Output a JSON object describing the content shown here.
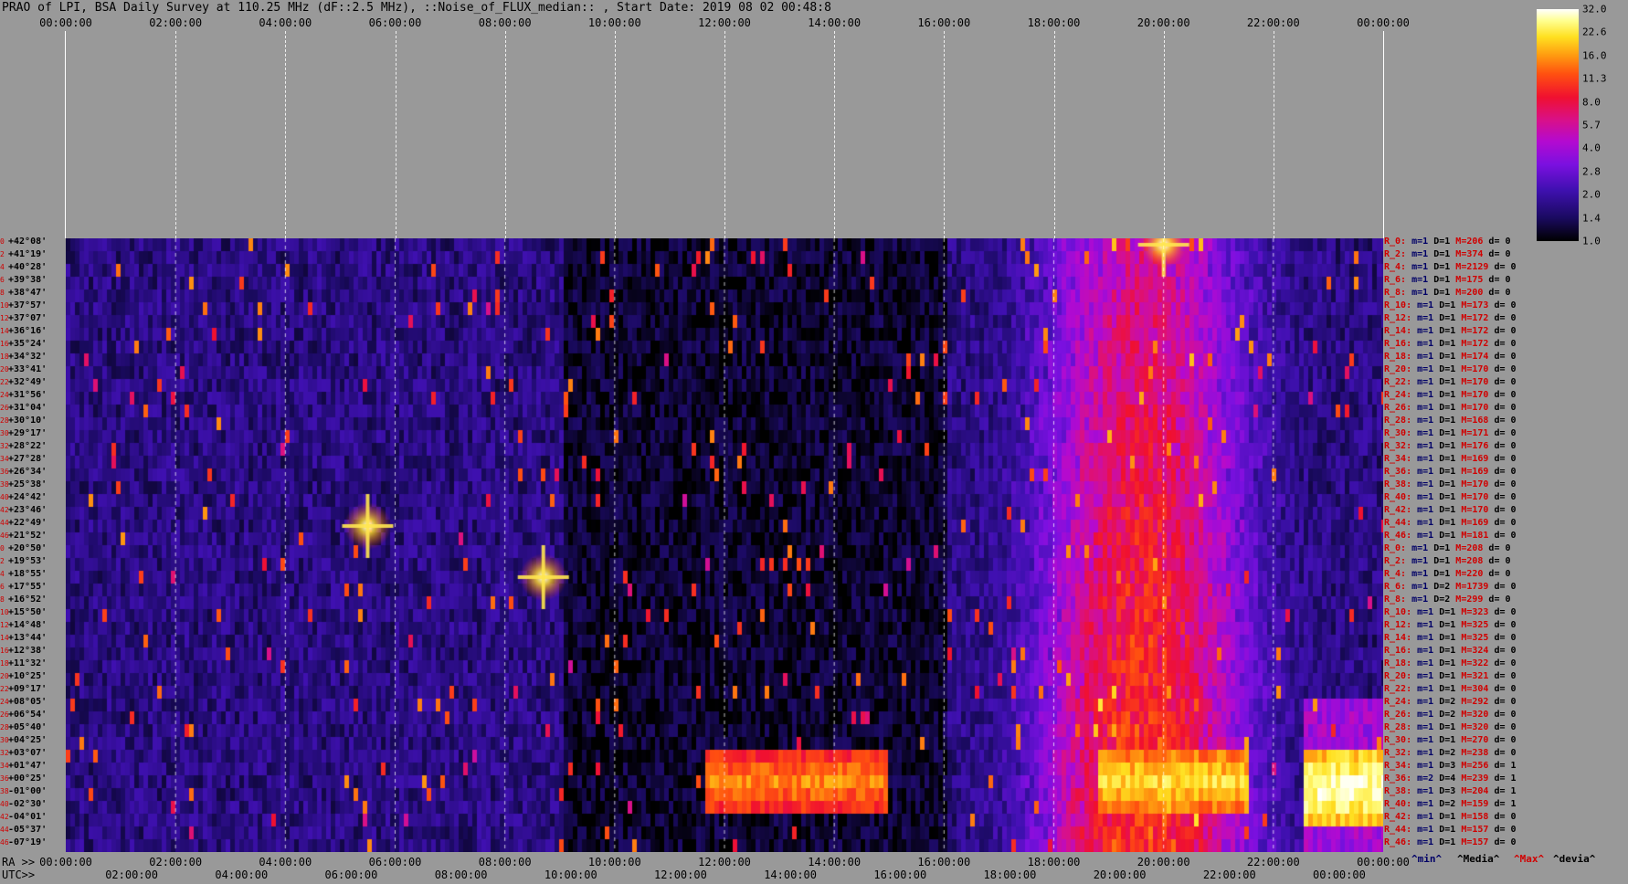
{
  "title": "PRAO of LPI, BSA Daily Survey at 110.25 MHz (dF::2.5 MHz), ::Noise_of_FLUX_median:: , Start Date: 2019 08 02 00:48:8",
  "top_ticks": [
    "00:00:00",
    "02:00:00",
    "04:00:00",
    "06:00:00",
    "08:00:00",
    "10:00:00",
    "12:00:00",
    "14:00:00",
    "16:00:00",
    "18:00:00",
    "20:00:00",
    "22:00:00",
    "00:00:00"
  ],
  "ra_prefix": "RA >>",
  "utc_prefix": "UTC>>",
  "ra_ticks": [
    "00:00:00",
    "02:00:00",
    "04:00:00",
    "06:00:00",
    "08:00:00",
    "10:00:00",
    "12:00:00",
    "14:00:00",
    "16:00:00",
    "18:00:00",
    "20:00:00",
    "22:00:00",
    "00:00:00"
  ],
  "utc_ticks": [
    "02:00:00",
    "04:00:00",
    "06:00:00",
    "08:00:00",
    "10:00:00",
    "12:00:00",
    "14:00:00",
    "16:00:00",
    "18:00:00",
    "20:00:00",
    "22:00:00",
    "00:00:00"
  ],
  "legend": {
    "min": "^min^",
    "median": "^Media^",
    "max": "^Max^",
    "devia": "^devia^",
    "min_color": "#000066",
    "median_color": "#000000",
    "max_color": "#d00000",
    "devia_color": "#000000"
  },
  "colorbar_ticks": [
    "32.0",
    "22.6",
    "16.0",
    "11.3",
    "8.0",
    "5.7",
    "4.0",
    "2.8",
    "2.0",
    "1.4",
    "1.0"
  ],
  "declinations": [
    "+42°08'",
    "+41°19'",
    "+40°28'",
    "+39°38'",
    "+38°47'",
    "+37°57'",
    "+37°07'",
    "+36°16'",
    "+35°24'",
    "+34°32'",
    "+33°41'",
    "+32°49'",
    "+31°56'",
    "+31°04'",
    "+30°10'",
    "+29°17'",
    "+28°22'",
    "+27°28'",
    "+26°34'",
    "+25°38'",
    "+24°42'",
    "+23°46'",
    "+22°49'",
    "+21°52'",
    "+20°50'",
    "+19°53'",
    "+18°55'",
    "+17°55'",
    "+16°52'",
    "+15°50'",
    "+14°48'",
    "+13°44'",
    "+12°38'",
    "+11°32'",
    "+10°25'",
    "+09°17'",
    "+08°05'",
    "+06°54'",
    "+05°40'",
    "+04°25'",
    "+03°07'",
    "+01°47'",
    "+00°25'",
    "-01°00'",
    "-02°30'",
    "-04°01'",
    "-05°37'",
    "-07°19'"
  ],
  "decl_indices": [
    "0",
    "2",
    "4",
    "6",
    "8",
    "10",
    "12",
    "14",
    "16",
    "18",
    "20",
    "22",
    "24",
    "26",
    "28",
    "30",
    "32",
    "34",
    "36",
    "38",
    "40",
    "42",
    "44",
    "46",
    "0",
    "2",
    "4",
    "6",
    "8",
    "10",
    "12",
    "14",
    "16",
    "18",
    "20",
    "22",
    "24",
    "26",
    "28",
    "30",
    "32",
    "34",
    "36",
    "38",
    "40",
    "42",
    "44",
    "46"
  ],
  "stats": [
    {
      "r": "R_0:",
      "m": "m=1",
      "D": "D=1",
      "M": "M=206",
      "d": "d= 0"
    },
    {
      "r": "R_2:",
      "m": "m=1",
      "D": "D=1",
      "M": "M=374",
      "d": "d= 0"
    },
    {
      "r": "R_4:",
      "m": "m=1",
      "D": "D=1",
      "M": "M=2129",
      "d": "d= 0"
    },
    {
      "r": "R_6:",
      "m": "m=1",
      "D": "D=1",
      "M": "M=175",
      "d": "d= 0"
    },
    {
      "r": "R_8:",
      "m": "m=1",
      "D": "D=1",
      "M": "M=200",
      "d": "d= 0"
    },
    {
      "r": "R_10:",
      "m": "m=1",
      "D": "D=1",
      "M": "M=173",
      "d": "d= 0"
    },
    {
      "r": "R_12:",
      "m": "m=1",
      "D": "D=1",
      "M": "M=172",
      "d": "d= 0"
    },
    {
      "r": "R_14:",
      "m": "m=1",
      "D": "D=1",
      "M": "M=172",
      "d": "d= 0"
    },
    {
      "r": "R_16:",
      "m": "m=1",
      "D": "D=1",
      "M": "M=172",
      "d": "d= 0"
    },
    {
      "r": "R_18:",
      "m": "m=1",
      "D": "D=1",
      "M": "M=174",
      "d": "d= 0"
    },
    {
      "r": "R_20:",
      "m": "m=1",
      "D": "D=1",
      "M": "M=170",
      "d": "d= 0"
    },
    {
      "r": "R_22:",
      "m": "m=1",
      "D": "D=1",
      "M": "M=170",
      "d": "d= 0"
    },
    {
      "r": "R_24:",
      "m": "m=1",
      "D": "D=1",
      "M": "M=170",
      "d": "d= 0"
    },
    {
      "r": "R_26:",
      "m": "m=1",
      "D": "D=1",
      "M": "M=170",
      "d": "d= 0"
    },
    {
      "r": "R_28:",
      "m": "m=1",
      "D": "D=1",
      "M": "M=168",
      "d": "d= 0"
    },
    {
      "r": "R_30:",
      "m": "m=1",
      "D": "D=1",
      "M": "M=171",
      "d": "d= 0"
    },
    {
      "r": "R_32:",
      "m": "m=1",
      "D": "D=1",
      "M": "M=176",
      "d": "d= 0"
    },
    {
      "r": "R_34:",
      "m": "m=1",
      "D": "D=1",
      "M": "M=169",
      "d": "d= 0"
    },
    {
      "r": "R_36:",
      "m": "m=1",
      "D": "D=1",
      "M": "M=169",
      "d": "d= 0"
    },
    {
      "r": "R_38:",
      "m": "m=1",
      "D": "D=1",
      "M": "M=170",
      "d": "d= 0"
    },
    {
      "r": "R_40:",
      "m": "m=1",
      "D": "D=1",
      "M": "M=170",
      "d": "d= 0"
    },
    {
      "r": "R_42:",
      "m": "m=1",
      "D": "D=1",
      "M": "M=170",
      "d": "d= 0"
    },
    {
      "r": "R_44:",
      "m": "m=1",
      "D": "D=1",
      "M": "M=169",
      "d": "d= 0"
    },
    {
      "r": "R_46:",
      "m": "m=1",
      "D": "D=1",
      "M": "M=181",
      "d": "d= 0"
    },
    {
      "r": "R_0:",
      "m": "m=1",
      "D": "D=1",
      "M": "M=208",
      "d": "d= 0"
    },
    {
      "r": "R_2:",
      "m": "m=1",
      "D": "D=1",
      "M": "M=208",
      "d": "d= 0"
    },
    {
      "r": "R_4:",
      "m": "m=1",
      "D": "D=1",
      "M": "M=220",
      "d": "d= 0"
    },
    {
      "r": "R_6:",
      "m": "m=1",
      "D": "D=2",
      "M": "M=1739",
      "d": "d= 0"
    },
    {
      "r": "R_8:",
      "m": "m=1",
      "D": "D=2",
      "M": "M=299",
      "d": "d= 0"
    },
    {
      "r": "R_10:",
      "m": "m=1",
      "D": "D=1",
      "M": "M=323",
      "d": "d= 0"
    },
    {
      "r": "R_12:",
      "m": "m=1",
      "D": "D=1",
      "M": "M=325",
      "d": "d= 0"
    },
    {
      "r": "R_14:",
      "m": "m=1",
      "D": "D=1",
      "M": "M=325",
      "d": "d= 0"
    },
    {
      "r": "R_16:",
      "m": "m=1",
      "D": "D=1",
      "M": "M=324",
      "d": "d= 0"
    },
    {
      "r": "R_18:",
      "m": "m=1",
      "D": "D=1",
      "M": "M=322",
      "d": "d= 0"
    },
    {
      "r": "R_20:",
      "m": "m=1",
      "D": "D=1",
      "M": "M=321",
      "d": "d= 0"
    },
    {
      "r": "R_22:",
      "m": "m=1",
      "D": "D=1",
      "M": "M=304",
      "d": "d= 0"
    },
    {
      "r": "R_24:",
      "m": "m=1",
      "D": "D=2",
      "M": "M=292",
      "d": "d= 0"
    },
    {
      "r": "R_26:",
      "m": "m=1",
      "D": "D=2",
      "M": "M=320",
      "d": "d= 0"
    },
    {
      "r": "R_28:",
      "m": "m=1",
      "D": "D=1",
      "M": "M=320",
      "d": "d= 0"
    },
    {
      "r": "R_30:",
      "m": "m=1",
      "D": "D=1",
      "M": "M=270",
      "d": "d= 0"
    },
    {
      "r": "R_32:",
      "m": "m=1",
      "D": "D=2",
      "M": "M=238",
      "d": "d= 0"
    },
    {
      "r": "R_34:",
      "m": "m=1",
      "D": "D=3",
      "M": "M=256",
      "d": "d= 1"
    },
    {
      "r": "R_36:",
      "m": "m=2",
      "D": "D=4",
      "M": "M=239",
      "d": "d= 1"
    },
    {
      "r": "R_38:",
      "m": "m=1",
      "D": "D=3",
      "M": "M=204",
      "d": "d= 1"
    },
    {
      "r": "R_40:",
      "m": "m=1",
      "D": "D=2",
      "M": "M=159",
      "d": "d= 1"
    },
    {
      "r": "R_42:",
      "m": "m=1",
      "D": "D=1",
      "M": "M=158",
      "d": "d= 0"
    },
    {
      "r": "R_44:",
      "m": "m=1",
      "D": "D=1",
      "M": "M=157",
      "d": "d= 0"
    },
    {
      "r": "R_46:",
      "m": "m=1",
      "D": "D=1",
      "M": "M=157",
      "d": "d= 0"
    }
  ],
  "chart_data": {
    "type": "heatmap",
    "title": "PRAO of LPI, BSA Daily Survey at 110.25 MHz (dF::2.5 MHz), ::Noise_of_FLUX_median:: , Start Date: 2019 08 02 00:48:8",
    "x_label": "RA / UTC",
    "x_ticks": [
      "00:00:00",
      "02:00:00",
      "04:00:00",
      "06:00:00",
      "08:00:00",
      "10:00:00",
      "12:00:00",
      "14:00:00",
      "16:00:00",
      "18:00:00",
      "20:00:00",
      "22:00:00",
      "00:00:00"
    ],
    "y_ticks_declination": [
      "+42°08'",
      "+41°19'",
      "+40°28'",
      "+39°38'",
      "+38°47'",
      "+37°57'",
      "+37°07'",
      "+36°16'",
      "+35°24'",
      "+34°32'",
      "+33°41'",
      "+32°49'",
      "+31°56'",
      "+31°04'",
      "+30°10'",
      "+29°17'",
      "+28°22'",
      "+27°28'",
      "+26°34'",
      "+25°38'",
      "+24°42'",
      "+23°46'",
      "+22°49'",
      "+21°52'",
      "+20°50'",
      "+19°53'",
      "+18°55'",
      "+17°55'",
      "+16°52'",
      "+15°50'",
      "+14°48'",
      "+13°44'",
      "+12°38'",
      "+11°32'",
      "+10°25'",
      "+09°17'",
      "+08°05'",
      "+06°54'",
      "+05°40'",
      "+04°25'",
      "+03°07'",
      "+01°47'",
      "+00°25'",
      "-01°00'",
      "-02°30'",
      "-04°01'",
      "-05°37'",
      "-07°19'"
    ],
    "colorbar": {
      "scale": "log2",
      "range": [
        1.0,
        32.0
      ],
      "ticks": [
        32.0,
        22.6,
        16.0,
        11.3,
        8.0,
        5.7,
        4.0,
        2.8,
        2.0,
        1.4,
        1.0
      ],
      "colormap": "black-blue-purple-red-orange-yellow-white"
    },
    "rows": 48,
    "columns_hours": 24,
    "features": [
      {
        "kind": "source",
        "ra_hours": 20.0,
        "row": 0,
        "peak": 32.0
      },
      {
        "kind": "source",
        "ra_hours": 8.7,
        "row": 26,
        "peak": 32.0
      },
      {
        "kind": "source",
        "ra_hours": 5.5,
        "row": 22,
        "peak": 22.6
      },
      {
        "kind": "band",
        "ra_hours_start": 11.6,
        "ra_hours_end": 14.9,
        "row_start": 40,
        "row_end": 44,
        "level": 16.0
      },
      {
        "kind": "band",
        "ra_hours_start": 18.8,
        "ra_hours_end": 21.5,
        "row_start": 40,
        "row_end": 44,
        "level": 22.6
      },
      {
        "kind": "band",
        "ra_hours_start": 22.5,
        "ra_hours_end": 24.0,
        "row_start": 40,
        "row_end": 45,
        "level": 32.0
      },
      {
        "kind": "galactic_plane",
        "ra_hours_center": 19.5,
        "level": 8.0
      }
    ]
  }
}
